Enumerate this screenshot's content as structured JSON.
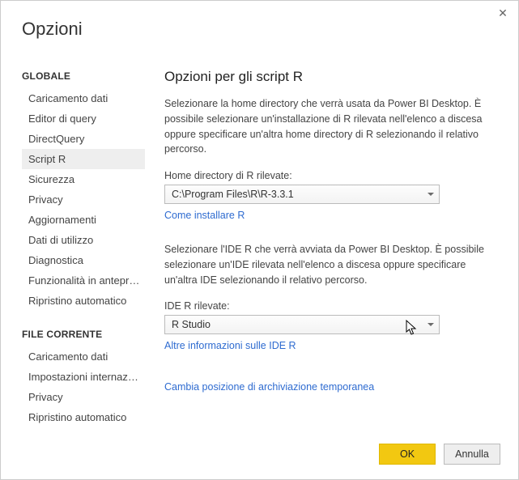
{
  "dialog_title": "Opzioni",
  "sidebar": {
    "section1_title": "GLOBALE",
    "items1": [
      "Caricamento dati",
      "Editor di query",
      "DirectQuery",
      "Script R",
      "Sicurezza",
      "Privacy",
      "Aggiornamenti",
      "Dati di utilizzo",
      "Diagnostica",
      "Funzionalità in anteprima",
      "Ripristino automatico"
    ],
    "selected1_index": 3,
    "section2_title": "FILE CORRENTE",
    "items2": [
      "Caricamento dati",
      "Impostazioni internazionali",
      "Privacy",
      "Ripristino automatico"
    ]
  },
  "content": {
    "heading": "Opzioni per gli script R",
    "para1": "Selezionare la home directory che verrà usata da Power BI Desktop. È possibile selezionare un'installazione di R rilevata nell'elenco a discesa oppure specificare un'altra home directory di R selezionando il relativo percorso.",
    "home_label": "Home directory di R rilevate:",
    "home_value": "C:\\Program Files\\R\\R-3.3.1",
    "home_link": "Come installare R",
    "para2": "Selezionare l'IDE R che verrà avviata da Power BI Desktop. È possibile selezionare un'IDE rilevata nell'elenco a discesa oppure specificare un'altra IDE selezionando il relativo percorso.",
    "ide_label": "IDE R rilevate:",
    "ide_value": "R Studio",
    "ide_link": "Altre informazioni sulle IDE R",
    "storage_link": "Cambia posizione di archiviazione temporanea"
  },
  "footer": {
    "ok": "OK",
    "cancel": "Annulla"
  }
}
